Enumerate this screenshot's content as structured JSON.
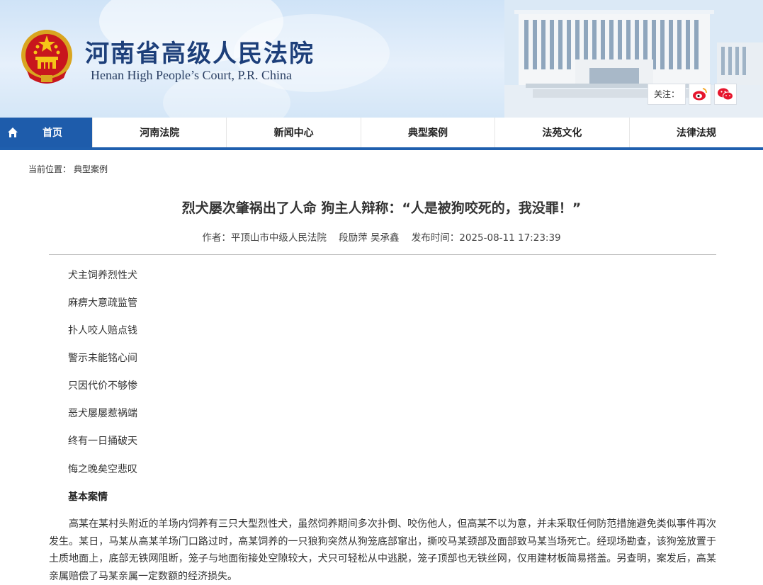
{
  "header": {
    "site_title_cn": "河南省高级人民法院",
    "site_title_en": "Henan High People’s Court, P.R. China",
    "follow_label": "关注：",
    "social": [
      "weibo-icon",
      "wechat-icon"
    ]
  },
  "nav": {
    "home": "首页",
    "items": [
      "河南法院",
      "新闻中心",
      "典型案例",
      "法苑文化",
      "法律法规"
    ]
  },
  "breadcrumb": {
    "label": "当前位置：",
    "current": "典型案例"
  },
  "article": {
    "title": "烈犬屡次肇祸出了人命 狗主人辩称：“人是被狗咬死的，我没罪！”",
    "author_label": "作者：",
    "author_org": "平顶山市中级人民法院",
    "authors": "段励萍 吴承鑫",
    "time_label": "发布时间：",
    "time": "2025-08-11 17:23:39",
    "poem": [
      "犬主饲养烈性犬",
      "麻痹大意疏监管",
      "扑人咬人赔点钱",
      "警示未能铭心间",
      "只因代价不够惨",
      "恶犬屡屡惹祸端",
      "终有一日捅破天",
      "悔之晚矣空悲叹"
    ],
    "section_heading": "基本案情",
    "paragraph": "高某在某村头附近的羊场内饲养有三只大型烈性犬，虽然饲养期间多次扑倒、咬伤他人，但高某不以为意，并未采取任何防范措施避免类似事件再次发生。某日，马某从高某羊场门口路过时，高某饲养的一只狼狗突然从狗笼底部窜出，撕咬马某颈部及面部致马某当场死亡。经现场勘查，该狗笼放置于土质地面上，底部无铁网阻断，笼子与地面衔接处空隙较大，犬只可轻松从中逃脱，笼子顶部也无铁丝网，仅用建材板简易搭盖。另查明，案发后，高某亲属赔偿了马某亲属一定数额的经济损失。"
  },
  "colors": {
    "nav_active": "#1e5cab",
    "title_blue": "#1d3f7a"
  }
}
